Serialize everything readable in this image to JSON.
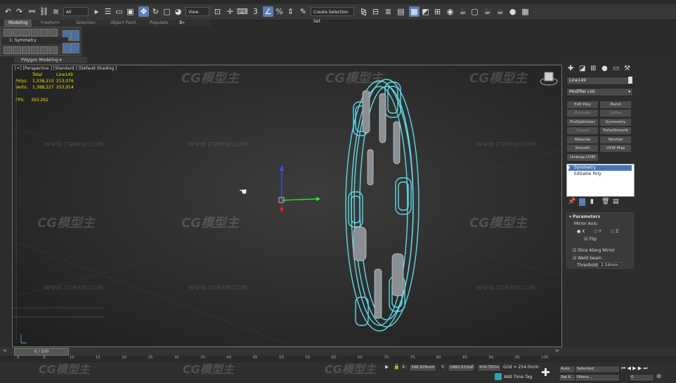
{
  "toolbar": {
    "filter_dropdown": "All",
    "view_dropdown": "View",
    "selection_set_placeholder": "Create Selection Set",
    "snap_label": "3"
  },
  "ribbon": {
    "tabs": [
      "Modeling",
      "Freeform",
      "Selection",
      "Object Paint",
      "Populate"
    ],
    "modifier_field": "1: Symmetry",
    "panel_label": "Polygon Modeling"
  },
  "viewport": {
    "label": "[+] [Perspective ] [Standard ] [Default Shading ]",
    "stats": {
      "header_total": "Total",
      "header_object": "Line149",
      "polys_label": "Polys:",
      "polys_total": "1,338,210",
      "polys_object": "213,076",
      "verts_label": "Verts:",
      "verts_total": "1,388,227",
      "verts_object": "253,914",
      "fps_label": "FPS:",
      "fps_value": "393.262"
    },
    "watermark_logo": "CG模型主",
    "watermark_url": "WWW.CGMXW.COM"
  },
  "command_panel": {
    "object_name": "Line149",
    "modifier_list": "Modifier List",
    "modifier_buttons": [
      {
        "label": "Edit Poly",
        "enabled": true
      },
      {
        "label": "Bend",
        "enabled": true
      },
      {
        "label": "Extrude",
        "enabled": false
      },
      {
        "label": "Lathe",
        "enabled": false
      },
      {
        "label": "ProOptimizer",
        "enabled": true
      },
      {
        "label": "Symmetry",
        "enabled": true
      },
      {
        "label": "Sweep",
        "enabled": false
      },
      {
        "label": "TurboSmooth",
        "enabled": true
      },
      {
        "label": "Material",
        "enabled": true
      },
      {
        "label": "Normal",
        "enabled": true
      },
      {
        "label": "Smooth",
        "enabled": true
      },
      {
        "label": "UVW Map",
        "enabled": true
      },
      {
        "label": "Unwrap UVW",
        "enabled": true
      }
    ],
    "stack": [
      "Symmetry",
      "Editable Poly"
    ],
    "params": {
      "title": "Parameters",
      "mirror_axis": "Mirror Axis:",
      "axes": [
        "X",
        "Y",
        "Z"
      ],
      "flip": "Flip",
      "slice": "Slice Along Mirror",
      "weld": "Weld Seam",
      "threshold_label": "Threshold:",
      "threshold_value": "2.54mm"
    }
  },
  "timeline": {
    "frame_display": "0 / 100",
    "ticks": [
      "0",
      "5",
      "10",
      "15",
      "20",
      "25",
      "30",
      "35",
      "40",
      "45",
      "50",
      "55",
      "60",
      "65",
      "70",
      "75",
      "80",
      "85",
      "90",
      "95",
      "100"
    ]
  },
  "status": {
    "x_label": "X:",
    "x_value": "396.976mm",
    "y_label": "Y:",
    "y_value": "1680.523m",
    "z_label": "Z:",
    "z_value": "474.797m",
    "grid": "Grid = 254.0mm",
    "add_time_tag": "Add Time Tag",
    "auto": "Auto",
    "set_key": "Set K.",
    "selected": "Selected",
    "filters": "Filters...",
    "frame_value": "0"
  },
  "colors": {
    "accent": "#5a7fb0",
    "wireframe": "#5fd9e8",
    "stats_text": "#e6e200"
  }
}
